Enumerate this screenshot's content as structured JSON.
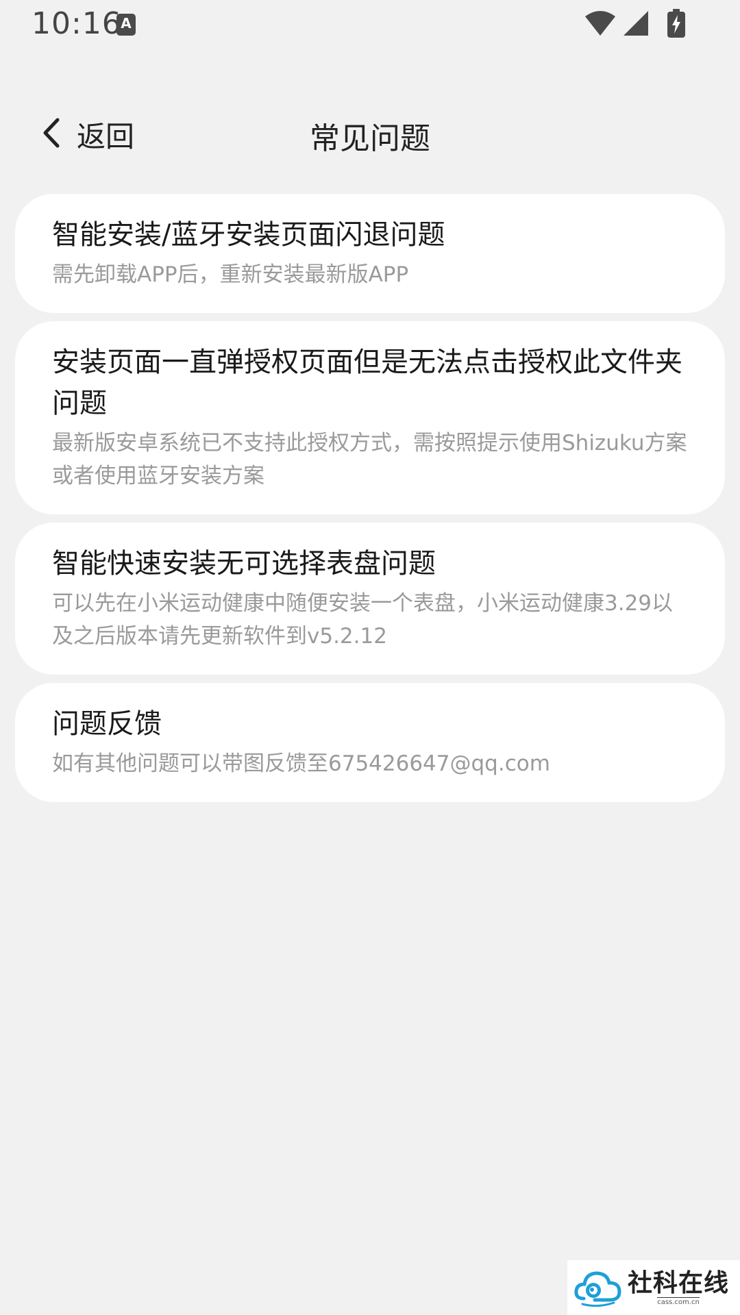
{
  "status_bar": {
    "time": "10:16",
    "keyboard_icon_letter": "A",
    "icons": [
      "wifi-icon",
      "signal-icon",
      "battery-charging-icon"
    ]
  },
  "header": {
    "back_label": "返回",
    "title": "常见问题"
  },
  "faq": [
    {
      "title": "智能安装/蓝牙安装页面闪退问题",
      "desc": "需先卸载APP后，重新安装最新版APP"
    },
    {
      "title": "安装页面一直弹授权页面但是无法点击授权此文件夹问题",
      "desc": "最新版安卓系统已不支持此授权方式，需按照提示使用Shizuku方案或者使用蓝牙安装方案"
    },
    {
      "title": "智能快速安装无可选择表盘问题",
      "desc": "可以先在小米运动健康中随便安装一个表盘，小米运动健康3.29以及之后版本请先更新软件到v5.2.12"
    },
    {
      "title": "问题反馈",
      "desc": "如有其他问题可以带图反馈至675426647@qq.com"
    }
  ],
  "watermark": {
    "title": "社科在线",
    "sub": "cass.com.cn"
  },
  "colors": {
    "background": "#f1f1f1",
    "card": "#ffffff",
    "title_text": "#1a1a1a",
    "desc_text": "#9a9a9a",
    "logo_accent": "#1e9fd8"
  }
}
